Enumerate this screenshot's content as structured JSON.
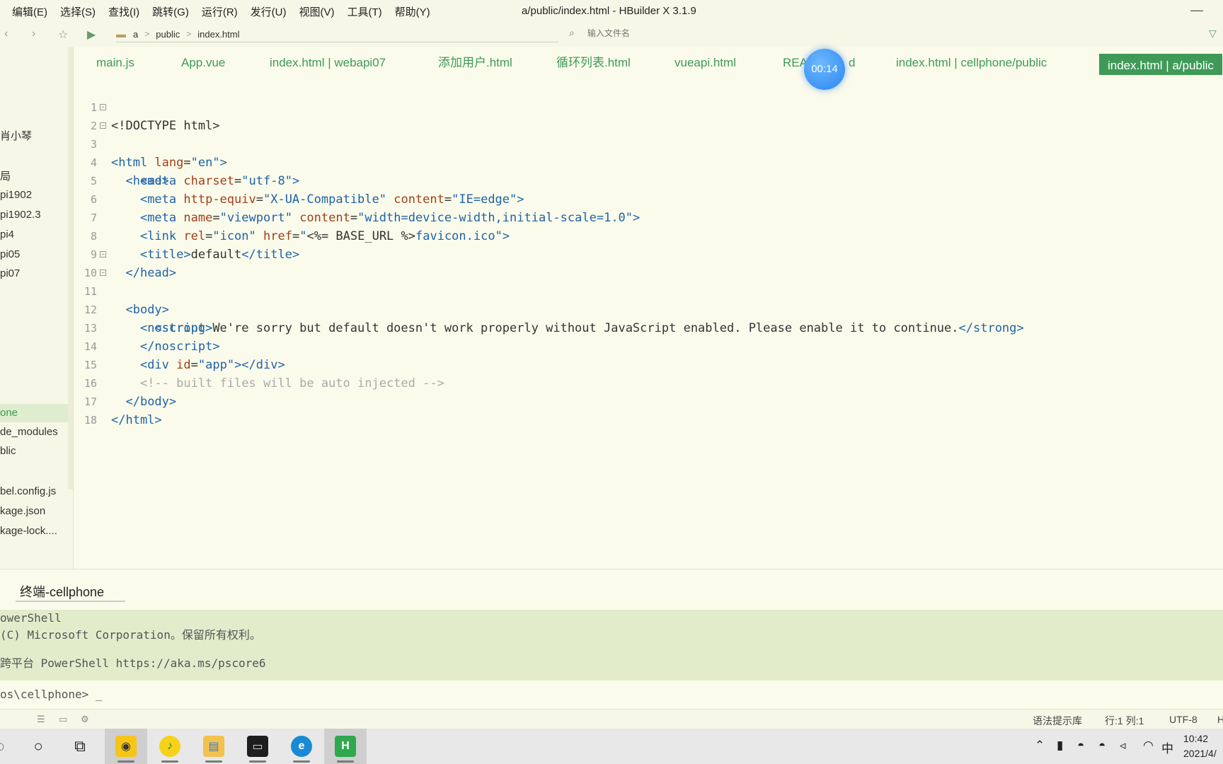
{
  "menu": [
    "编辑(E)",
    "选择(S)",
    "查找(I)",
    "跳转(G)",
    "运行(R)",
    "发行(U)",
    "视图(V)",
    "工具(T)",
    "帮助(Y)"
  ],
  "window_title": "a/public/index.html - HBuilder X 3.1.9",
  "breadcrumb": [
    "a",
    "public",
    "index.html"
  ],
  "file_search_placeholder": "输入文件名",
  "sidebar": {
    "items": [
      "肖小琴",
      "局",
      "pi1902",
      "pi1902.3",
      "pi4",
      "pi05",
      "pi07",
      "one",
      "de_modules",
      "blic",
      "bel.config.js",
      "kage.json",
      "kage-lock...."
    ]
  },
  "tabs": [
    "main.js",
    "App.vue",
    "index.html | webapi07",
    "添加用户.html",
    "循环列表.html",
    "vueapi.html",
    "REA",
    "d",
    "index.html | cellphone/public",
    "index.html | a/public"
  ],
  "timer": "00:14",
  "editor": {
    "line_numbers": [
      "1",
      "2",
      "3",
      "4",
      "5",
      "6",
      "7",
      "8",
      "9",
      "10",
      "11",
      "12",
      "13",
      "14",
      "15",
      "16",
      "17",
      "18"
    ]
  },
  "terminal": {
    "tab_label": "终端-cellphone",
    "lines": [
      "owerShell",
      "(C) Microsoft Corporation。保留所有权利。",
      "",
      "跨平台 PowerShell https://aka.ms/pscore6"
    ],
    "prompt": "os\\cellphone> _"
  },
  "statusbar": {
    "syntax_lib": "语法提示库",
    "position": "行:1  列:1",
    "encoding": "UTF-8",
    "extra": "H"
  },
  "taskbar": {
    "clock_time": "10:42",
    "clock_date": "2021/4/",
    "ime": "中"
  },
  "colors": {
    "accent": "#3f9a57",
    "editor_bg": "#fbfbeb",
    "terminal_bg": "#e2eccb",
    "tag": "#1e62a8",
    "attr": "#a0401a"
  }
}
